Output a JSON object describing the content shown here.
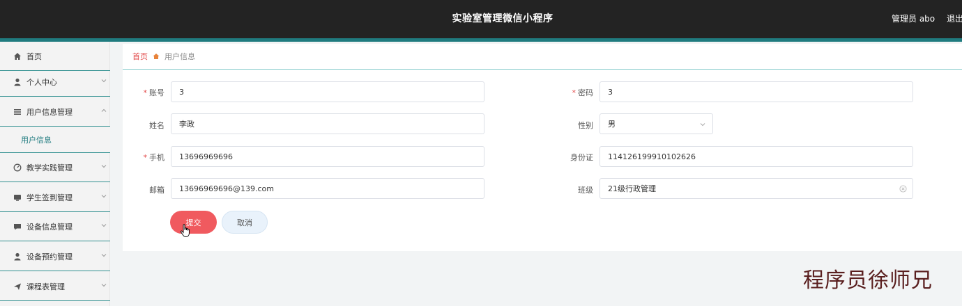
{
  "header": {
    "app_title": "实验室管理微信小程序",
    "admin_label": "管理员 abo",
    "logout_label": "退出"
  },
  "sidebar": {
    "items": [
      {
        "label": "首页",
        "icon": "home-icon",
        "expandable": false
      },
      {
        "label": "个人中心",
        "icon": "user-icon",
        "expandable": true
      },
      {
        "label": "用户信息管理",
        "icon": "list-icon",
        "expandable": true,
        "expanded": true
      },
      {
        "label": "教学实践管理",
        "icon": "gauge-icon",
        "expandable": true
      },
      {
        "label": "学生签到管理",
        "icon": "monitor-icon",
        "expandable": true
      },
      {
        "label": "设备信息管理",
        "icon": "chat-icon",
        "expandable": true
      },
      {
        "label": "设备预约管理",
        "icon": "user-icon",
        "expandable": true
      },
      {
        "label": "课程表管理",
        "icon": "send-icon",
        "expandable": true
      }
    ],
    "submenu": {
      "label": "用户信息"
    }
  },
  "breadcrumb": {
    "home": "首页",
    "current": "用户信息"
  },
  "form": {
    "account": {
      "label": "账号",
      "value": "3",
      "required": true
    },
    "password": {
      "label": "密码",
      "value": "3",
      "required": true
    },
    "name": {
      "label": "姓名",
      "value": "李政"
    },
    "gender": {
      "label": "性别",
      "value": "男"
    },
    "phone": {
      "label": "手机",
      "value": "13696969696",
      "required": true
    },
    "id_card": {
      "label": "身份证",
      "value": "114126199910102626"
    },
    "email": {
      "label": "邮箱",
      "value": "13696969696@139.com"
    },
    "class": {
      "label": "班级",
      "value": "21级行政管理"
    }
  },
  "buttons": {
    "submit": "提交",
    "cancel": "取消"
  },
  "watermark": "程序员徐师兄",
  "colors": {
    "topbar": "#232323",
    "accent": "#1f7b7f",
    "submit": "#f05a5f",
    "breadcrumb_home": "#e24a4a"
  }
}
